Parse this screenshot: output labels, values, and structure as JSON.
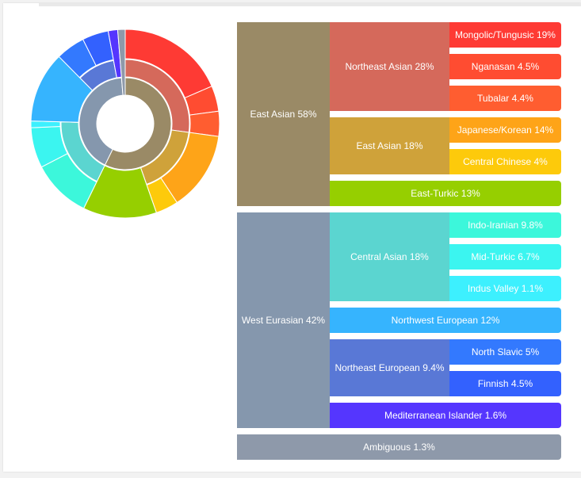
{
  "chart_data": {
    "type": "sunburst",
    "levels": [
      {
        "label": "East Asian 58%",
        "color": "#9a8a66",
        "children": [
          {
            "label": "Northeast Asian 28%",
            "color": "#d5695b",
            "children": [
              {
                "label": "Mongolic/Tungusic 19%",
                "color": "#fe3a34"
              },
              {
                "label": "Nganasan 4.5%",
                "color": "#ff4c31"
              },
              {
                "label": "Tubalar 4.4%",
                "color": "#ff5d30"
              }
            ]
          },
          {
            "label": "East Asian 18%",
            "color": "#cfa23a",
            "children": [
              {
                "label": "Japanese/Korean 14%",
                "color": "#fea418"
              },
              {
                "label": "Central Chinese 4%",
                "color": "#fdca0b"
              }
            ]
          },
          {
            "label": "East-Turkic 13%",
            "color": "#96cf00"
          }
        ]
      },
      {
        "label": "West Eurasian 42%",
        "color": "#8597ad",
        "children": [
          {
            "label": "Central Asian 18%",
            "color": "#5bd5d0",
            "children": [
              {
                "label": "Indo-Iranian 9.8%",
                "color": "#3cf7db"
              },
              {
                "label": "Mid-Turkic 6.7%",
                "color": "#3bf5f0"
              },
              {
                "label": "Indus Valley 1.1%",
                "color": "#3df0fe"
              }
            ]
          },
          {
            "label": "Northwest European 12%",
            "color": "#36b4fe"
          },
          {
            "label": "Northeast European 9.4%",
            "color": "#5978d6",
            "children": [
              {
                "label": "North Slavic 5%",
                "color": "#3379fe"
              },
              {
                "label": "Finnish 4.5%",
                "color": "#3361fe"
              }
            ]
          },
          {
            "label": "Mediterranean Islander 1.6%",
            "color": "#5536fe"
          }
        ]
      },
      {
        "label": "Ambiguous 1.3%",
        "color": "#8e99aa"
      }
    ]
  }
}
